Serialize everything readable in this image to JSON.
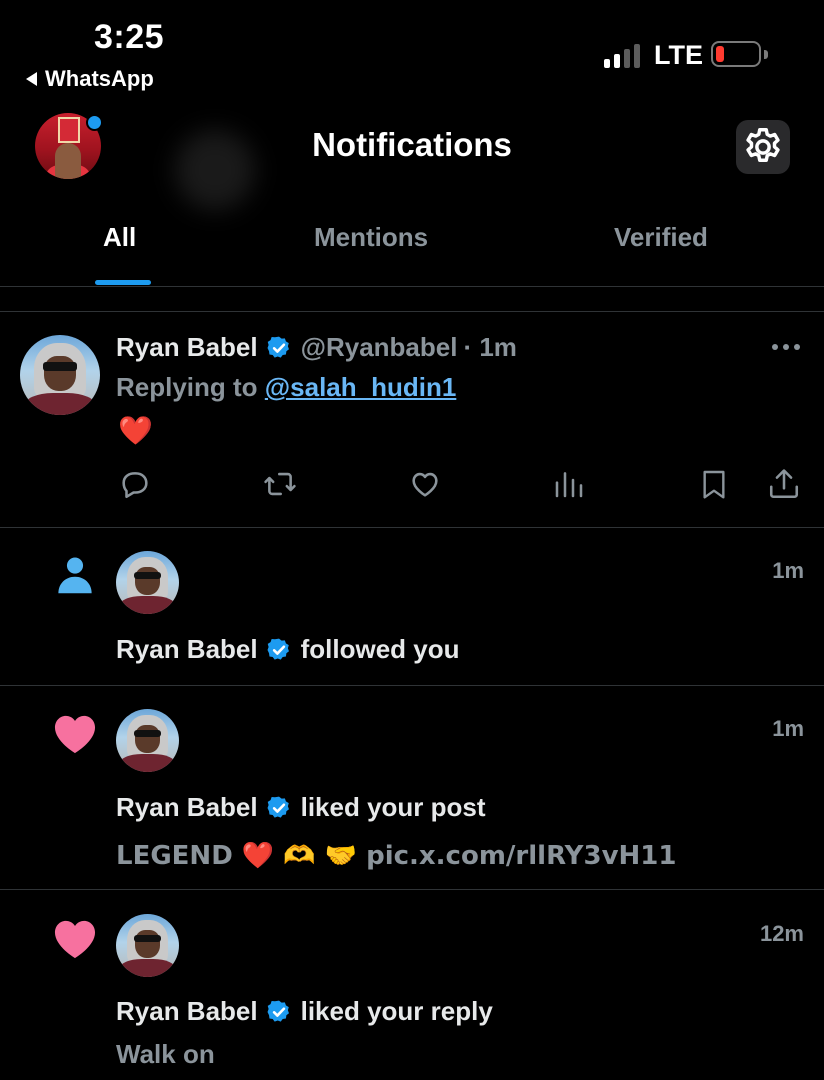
{
  "status_bar": {
    "time": "3:25",
    "back_label": "WhatsApp",
    "network": "LTE",
    "signal_bars_active": 2,
    "signal_bars_total": 4,
    "battery_level": 0.1
  },
  "header": {
    "title": "Notifications",
    "settings_icon": "gear-icon"
  },
  "tabs": [
    {
      "label": "All",
      "active": true
    },
    {
      "label": "Mentions",
      "active": false
    },
    {
      "label": "Verified",
      "active": false
    }
  ],
  "reply": {
    "name": "Ryan Babel",
    "handle": "@Ryanbabel",
    "time": "· 1m",
    "replying_prefix": "Replying to",
    "replying_to": "@salah_hudin1",
    "content": "❤️",
    "actions": [
      "reply-icon",
      "repost-icon",
      "like-icon",
      "views-icon",
      "bookmark-icon",
      "share-icon"
    ]
  },
  "notifications": [
    {
      "type": "follow",
      "icon": "person-icon",
      "time": "1m",
      "name": "Ryan Babel",
      "action": "followed you",
      "snippet": ""
    },
    {
      "type": "like",
      "icon": "heart-icon",
      "time": "1m",
      "name": "Ryan Babel",
      "action": "liked your post",
      "snippet": "LEGEND ❤️ 🫶 🤝 pic.x.com/rllRY3vH11"
    },
    {
      "type": "like",
      "icon": "heart-icon",
      "time": "12m",
      "name": "Ryan Babel",
      "action": "liked your reply",
      "snippet": "Walk on"
    }
  ],
  "colors": {
    "accent": "#1d9bf0",
    "like": "#f7719f",
    "follow": "#55b4f0",
    "muted_text": "#8b949b",
    "divider": "#2f3336"
  }
}
